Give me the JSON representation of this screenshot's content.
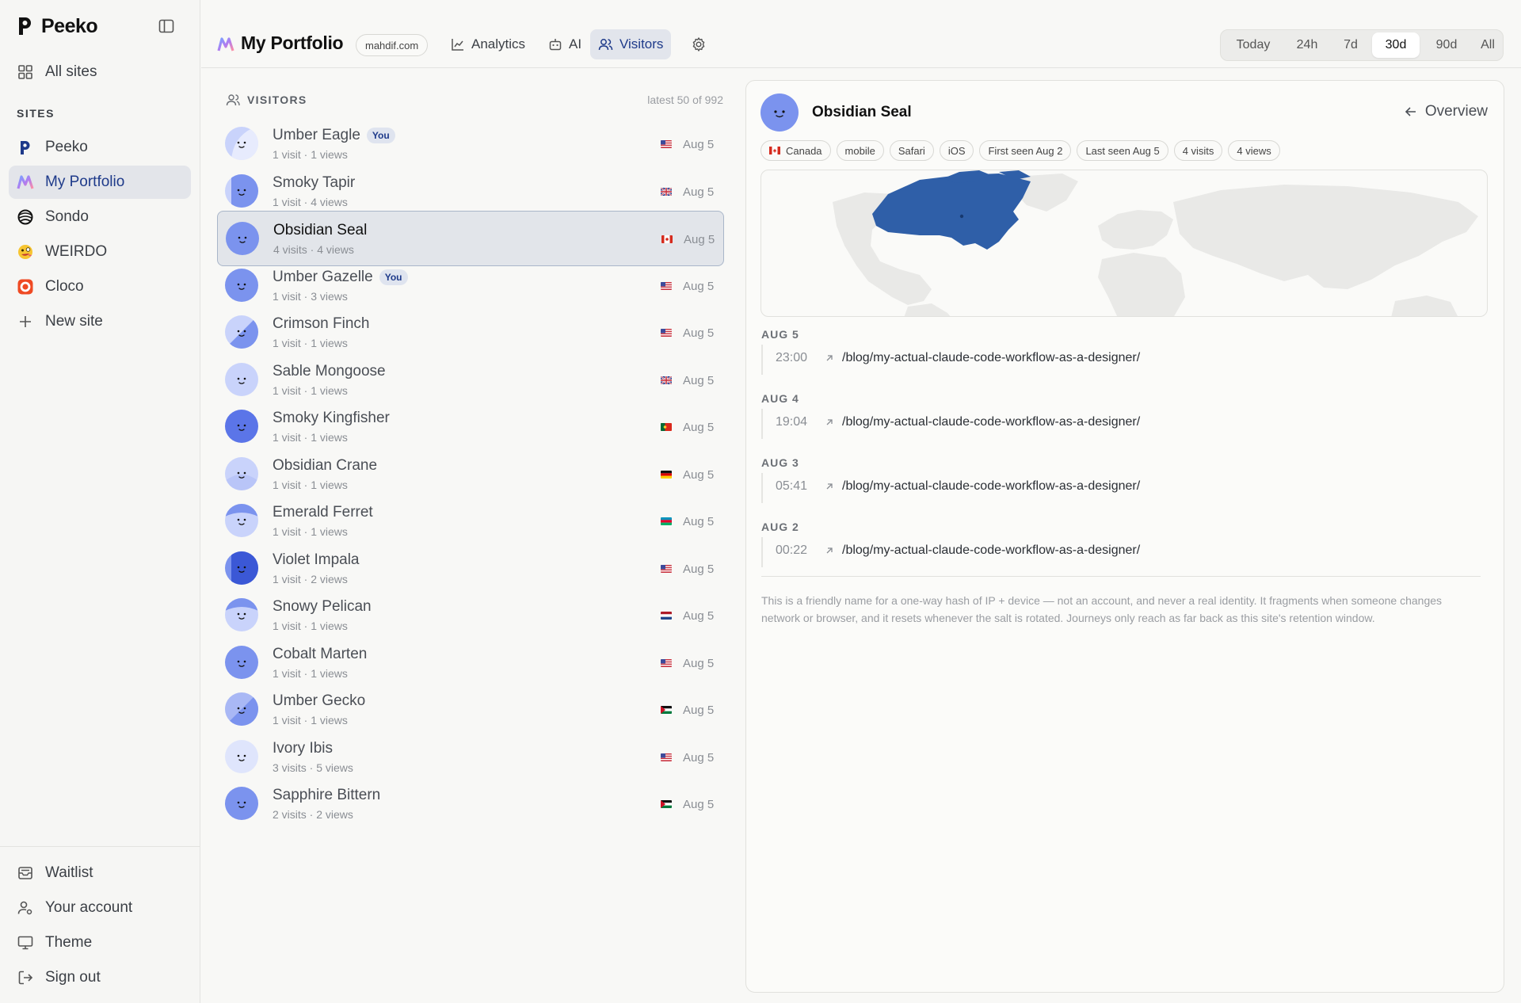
{
  "sidebar": {
    "brand": "Peeko",
    "all_sites": "All sites",
    "sites_label": "SITES",
    "sites": [
      {
        "label": "Peeko",
        "icon": "peeko-logo-icon"
      },
      {
        "label": "My Portfolio",
        "icon": "portfolio-logo-icon",
        "active": true
      },
      {
        "label": "Sondo",
        "icon": "sondo-logo-icon"
      },
      {
        "label": "WEIRDO",
        "icon": "weirdo-emoji-icon"
      },
      {
        "label": "Cloco",
        "icon": "cloco-logo-icon"
      }
    ],
    "new_site": "New site",
    "bottom": [
      {
        "label": "Waitlist",
        "icon": "mail-icon"
      },
      {
        "label": "Your account",
        "icon": "user-settings-icon"
      },
      {
        "label": "Theme",
        "icon": "monitor-icon"
      },
      {
        "label": "Sign out",
        "icon": "sign-out-icon"
      }
    ]
  },
  "header": {
    "title": "My Portfolio",
    "domain": "mahdif.com",
    "tabs": [
      {
        "label": "Analytics",
        "icon": "chart-icon"
      },
      {
        "label": "AI",
        "icon": "robot-icon"
      },
      {
        "label": "Visitors",
        "icon": "users-icon",
        "active": true
      }
    ],
    "ranges": [
      "Today",
      "24h",
      "7d",
      "30d",
      "90d",
      "All"
    ],
    "active_range": "30d"
  },
  "visitors": {
    "header": "VISITORS",
    "meta": "latest 50 of 992",
    "you_label": "You",
    "items": [
      {
        "name": "Umber Eagle",
        "you": true,
        "sub": "1 visit · 1 views",
        "country": "US",
        "date": "Aug 5"
      },
      {
        "name": "Smoky Tapir",
        "sub": "1 visit · 4 views",
        "country": "GB",
        "date": "Aug 5"
      },
      {
        "name": "Obsidian Seal",
        "sub": "4 visits · 4 views",
        "country": "CA",
        "date": "Aug 5",
        "selected": true
      },
      {
        "name": "Umber Gazelle",
        "you": true,
        "sub": "1 visit · 3 views",
        "country": "US",
        "date": "Aug 5"
      },
      {
        "name": "Crimson Finch",
        "sub": "1 visit · 1 views",
        "country": "US",
        "date": "Aug 5"
      },
      {
        "name": "Sable Mongoose",
        "sub": "1 visit · 1 views",
        "country": "GB",
        "date": "Aug 5"
      },
      {
        "name": "Smoky Kingfisher",
        "sub": "1 visit · 1 views",
        "country": "PT",
        "date": "Aug 5"
      },
      {
        "name": "Obsidian Crane",
        "sub": "1 visit · 1 views",
        "country": "DE",
        "date": "Aug 5"
      },
      {
        "name": "Emerald Ferret",
        "sub": "1 visit · 1 views",
        "country": "AZ",
        "date": "Aug 5"
      },
      {
        "name": "Violet Impala",
        "sub": "1 visit · 2 views",
        "country": "US",
        "date": "Aug 5"
      },
      {
        "name": "Snowy Pelican",
        "sub": "1 visit · 1 views",
        "country": "NL",
        "date": "Aug 5"
      },
      {
        "name": "Cobalt Marten",
        "sub": "1 visit · 1 views",
        "country": "US",
        "date": "Aug 5"
      },
      {
        "name": "Umber Gecko",
        "sub": "1 visit · 1 views",
        "country": "JO",
        "date": "Aug 5"
      },
      {
        "name": "Ivory Ibis",
        "sub": "3 visits · 5 views",
        "country": "US",
        "date": "Aug 5"
      },
      {
        "name": "Sapphire Bittern",
        "sub": "2 visits · 2 views",
        "country": "JO",
        "date": "Aug 5"
      }
    ]
  },
  "detail": {
    "name": "Obsidian Seal",
    "overview": "Overview",
    "chips": [
      "Canada",
      "mobile",
      "Safari",
      "iOS",
      "First seen Aug 2",
      "Last seen Aug 5",
      "4 visits",
      "4 views"
    ],
    "days": [
      {
        "label": "AUG 5",
        "time": "23:00",
        "path": "/blog/my-actual-claude-code-workflow-as-a-designer/"
      },
      {
        "label": "AUG 4",
        "time": "19:04",
        "path": "/blog/my-actual-claude-code-workflow-as-a-designer/"
      },
      {
        "label": "AUG 3",
        "time": "05:41",
        "path": "/blog/my-actual-claude-code-workflow-as-a-designer/"
      },
      {
        "label": "AUG 2",
        "time": "00:22",
        "path": "/blog/my-actual-claude-code-workflow-as-a-designer/"
      }
    ],
    "note": "This is a friendly name for a one-way hash of IP + device — not an account, and never a real identity. It fragments when someone changes network or browser, and it resets whenever the salt is rotated. Journeys only reach as far back as this site's retention window."
  },
  "colors": {
    "accent": "#1e3a8a",
    "avatar": "#7b93ee",
    "map_highlight": "#2f5fa8",
    "map_land": "#e9e9e7"
  }
}
